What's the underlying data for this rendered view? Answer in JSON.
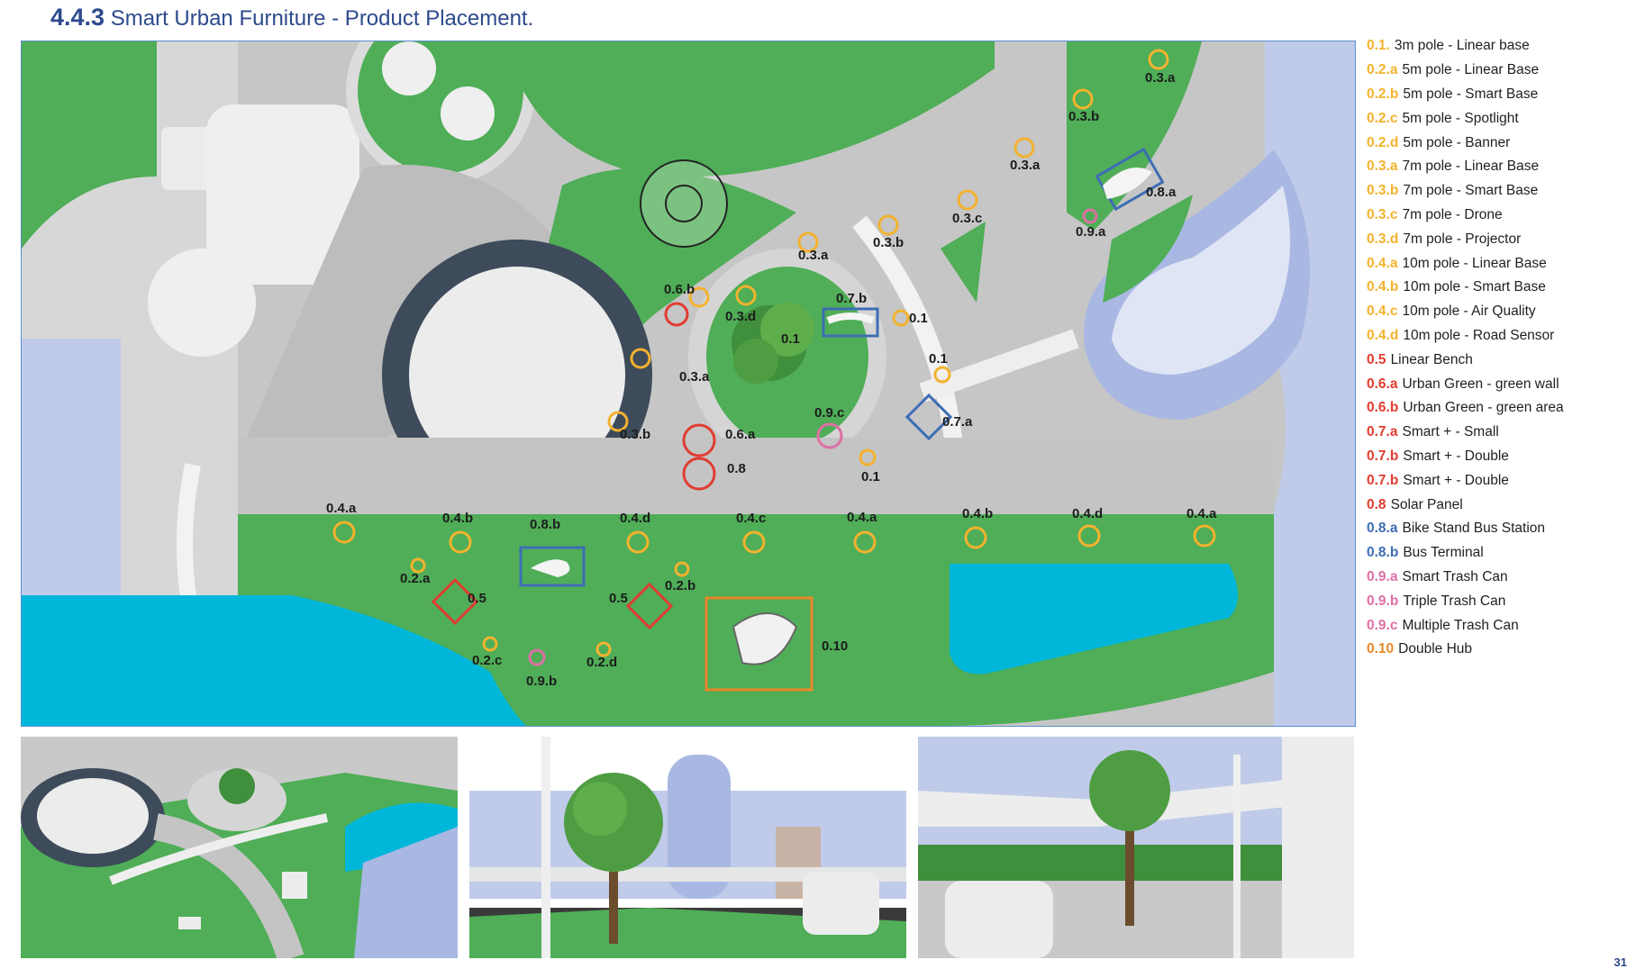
{
  "header": {
    "number": "4.4.3",
    "title": "Smart Urban Furniture - Product Placement."
  },
  "colors": {
    "yellow": "#f4b22e",
    "red": "#e03c31",
    "blue": "#3d6db4",
    "pink": "#dd6fa5",
    "orange": "#e8872a",
    "green": "#4fae57",
    "title": "#2e4a8e"
  },
  "legend": [
    {
      "code": "0.1.",
      "label": "3m pole - Linear base",
      "color": "#f4b22e"
    },
    {
      "code": "0.2.a",
      "label": "5m pole - Linear Base",
      "color": "#f4b22e"
    },
    {
      "code": "0.2.b",
      "label": "5m pole - Smart Base",
      "color": "#f4b22e"
    },
    {
      "code": "0.2.c",
      "label": "5m pole - Spotlight",
      "color": "#f4b22e"
    },
    {
      "code": "0.2.d",
      "label": "5m pole - Banner",
      "color": "#f4b22e"
    },
    {
      "code": "0.3.a",
      "label": "7m pole - Linear Base",
      "color": "#f4b22e"
    },
    {
      "code": "0.3.b",
      "label": "7m pole - Smart Base",
      "color": "#f4b22e"
    },
    {
      "code": "0.3.c",
      "label": "7m pole - Drone",
      "color": "#f4b22e"
    },
    {
      "code": "0.3.d",
      "label": "7m pole - Projector",
      "color": "#f4b22e"
    },
    {
      "code": "0.4.a",
      "label": "10m pole - Linear Base",
      "color": "#f4b22e"
    },
    {
      "code": "0.4.b",
      "label": "10m pole - Smart Base",
      "color": "#f4b22e"
    },
    {
      "code": "0.4.c",
      "label": "10m pole - Air Quality",
      "color": "#f4b22e"
    },
    {
      "code": "0.4.d",
      "label": "10m pole - Road Sensor",
      "color": "#f4b22e"
    },
    {
      "code": "0.5",
      "label": "Linear Bench",
      "color": "#e03c31"
    },
    {
      "code": "0.6.a",
      "label": "Urban Green - green wall",
      "color": "#e03c31"
    },
    {
      "code": "0.6.b",
      "label": "Urban Green - green area",
      "color": "#e03c31"
    },
    {
      "code": "0.7.a",
      "label": "Smart + - Small",
      "color": "#e03c31"
    },
    {
      "code": "0.7.b",
      "label": "Smart + - Double",
      "color": "#e03c31"
    },
    {
      "code": "0.7.b",
      "label": "Smart + - Double",
      "color": "#e03c31"
    },
    {
      "code": "0.8",
      "label": "Solar Panel",
      "color": "#e03c31"
    },
    {
      "code": "0.8.a",
      "label": "Bike Stand Bus Station",
      "color": "#3d6db4"
    },
    {
      "code": "0.8.b",
      "label": "Bus Terminal",
      "color": "#3d6db4"
    },
    {
      "code": "0.9.a",
      "label": "Smart Trash Can",
      "color": "#dd6fa5"
    },
    {
      "code": "0.9.b",
      "label": "Triple Trash Can",
      "color": "#dd6fa5"
    },
    {
      "code": "0.9.c",
      "label": "Multiple Trash Can",
      "color": "#dd6fa5"
    },
    {
      "code": "0.10",
      "label": "Double Hub",
      "color": "#e8872a"
    }
  ],
  "map_labels": {
    "l03a_top": "0.3.a",
    "l03b_top": "0.3.b",
    "l03a_mid": "0.3.a",
    "l03c": "0.3.c",
    "l08a": "0.8.a",
    "l09a": "0.9.a",
    "l03b_b": "0.3.b",
    "l03a_c": "0.3.a",
    "l06b": "0.6.b",
    "l03d": "0.3.d",
    "l07b": "0.7.b",
    "l01_a": "0.1",
    "l01_b": "0.1",
    "l01_c": "0.1",
    "l03a_d": "0.3.a",
    "l09c": "0.9.c",
    "l07a": "0.7.a",
    "l03b_c": "0.3.b",
    "l06a": "0.6.a",
    "l08": "0.8",
    "l01_d": "0.1",
    "l04a_1": "0.4.a",
    "l04b_1": "0.4.b",
    "l08b": "0.8.b",
    "l04d_1": "0.4.d",
    "l04c": "0.4.c",
    "l04a_2": "0.4.a",
    "l04b_2": "0.4.b",
    "l04d_2": "0.4.d",
    "l04a_3": "0.4.a",
    "l02a": "0.2.a",
    "l05_1": "0.5",
    "l05_2": "0.5",
    "l02b": "0.2.b",
    "l02c": "0.2.c",
    "l09b": "0.9.b",
    "l02d": "0.2.d",
    "l010": "0.10"
  },
  "page_number": "31"
}
